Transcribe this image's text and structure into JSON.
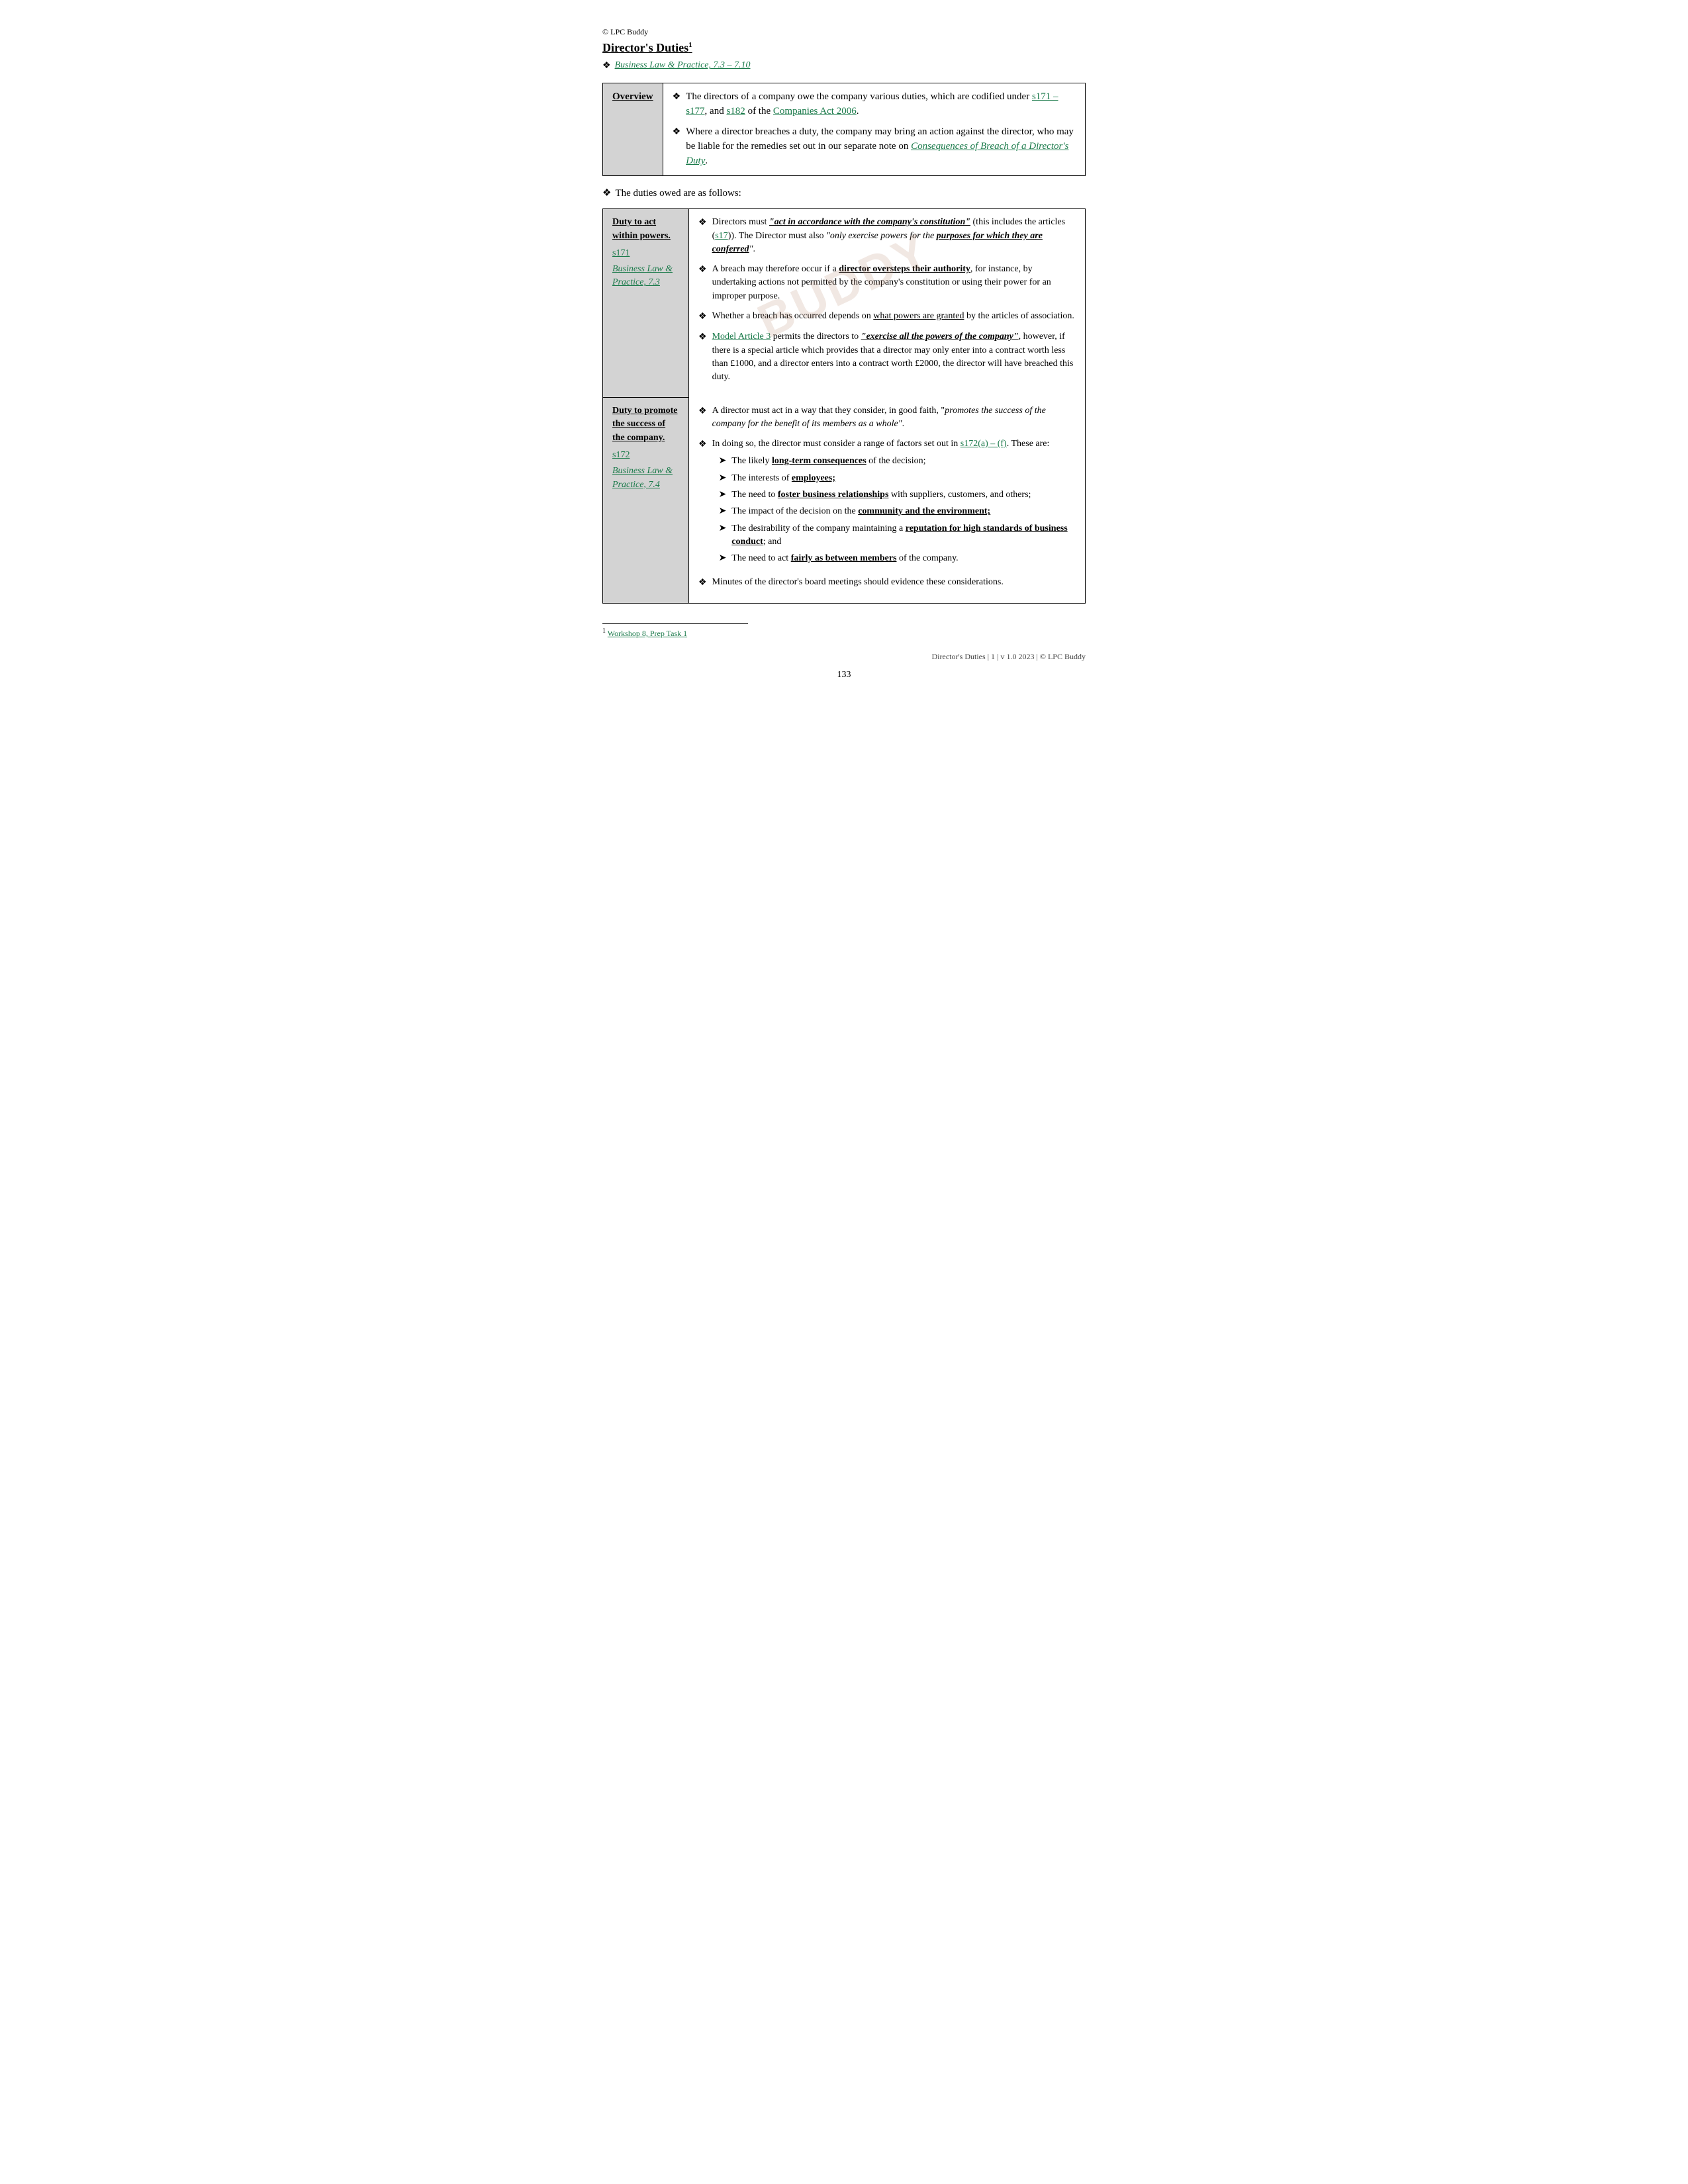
{
  "header": {
    "copyright": "© LPC Buddy",
    "title": "Director's Duties",
    "title_superscript": "1",
    "reference_text": "Business Law & Practice, 7.3 – 7.10"
  },
  "overview": {
    "label": "Overview",
    "items": [
      {
        "text_before": "The directors of a company owe the company various duties, which are codified under ",
        "link1_text": "s171 – s177",
        "link1_href": "#s171",
        "text_middle": ", and ",
        "link2_text": "s182",
        "link2_href": "#s182",
        "text_after": " of the ",
        "link3_text": "Companies Act 2006",
        "link3_href": "#ca2006",
        "text_end": "."
      },
      {
        "text_before": "Where a director breaches a duty, the company may bring an action against the director, who may be liable for the remedies set out in our separate note on ",
        "link_text": "Consequences of Breach of a Director's Duty",
        "link_href": "#consequences",
        "text_after": "."
      }
    ]
  },
  "duties_intro": "The duties owed are as follows:",
  "duties": [
    {
      "left": {
        "title": "Duty to act within powers.",
        "refs": [
          {
            "text": "s171",
            "href": "#s171"
          },
          {
            "text": "Business Law & Practice, 7.3",
            "href": "#blp73"
          }
        ]
      },
      "right": {
        "bullets": [
          {
            "type": "text",
            "parts": [
              {
                "text": "Directors must ",
                "style": "normal"
              },
              {
                "text": "“act in accordance with the company’s constitution”",
                "style": "bold-italic-underline"
              },
              {
                "text": " (this includes the articles (",
                "style": "normal"
              },
              {
                "text": "s17",
                "style": "link",
                "href": "#s17"
              },
              {
                "text": ")). The Director must also ",
                "style": "normal"
              },
              {
                "text": "“only exercise powers for the ",
                "style": "italic"
              },
              {
                "text": "purposes for which they are conferred",
                "style": "bold-italic-underline"
              },
              {
                "text": "”.",
                "style": "italic"
              }
            ]
          },
          {
            "type": "text",
            "parts": [
              {
                "text": "A breach may therefore occur if a ",
                "style": "normal"
              },
              {
                "text": "director oversteps their authority",
                "style": "bold-underline"
              },
              {
                "text": ", for instance, by undertaking actions not permitted by the company’s constitution or using their power for an improper purpose.",
                "style": "normal"
              }
            ]
          },
          {
            "type": "text",
            "parts": [
              {
                "text": "Whether a breach has occurred depends on ",
                "style": "normal"
              },
              {
                "text": "what powers are granted",
                "style": "underline"
              },
              {
                "text": " by the articles of association.",
                "style": "normal"
              }
            ]
          },
          {
            "type": "text",
            "parts": [
              {
                "text": "Model Article 3",
                "style": "link",
                "href": "#model3"
              },
              {
                "text": " permits the directors to ",
                "style": "normal"
              },
              {
                "text": "“exercise all the powers of the company”",
                "style": "bold-italic-underline"
              },
              {
                "text": ", however, if there is a special article which provides that a director may only enter into a contract worth less than £1000, and a director enters into a contract worth £2000, the director will have breached this duty.",
                "style": "normal"
              }
            ]
          }
        ]
      }
    },
    {
      "left": {
        "title": "Duty to promote the success of the company.",
        "refs": [
          {
            "text": "s172",
            "href": "#s172"
          },
          {
            "text": "Business Law & Practice, 7.4",
            "href": "#blp74"
          }
        ]
      },
      "right": {
        "bullets": [
          {
            "type": "text",
            "parts": [
              {
                "text": "A director must act in a way that they consider, in good faith, “",
                "style": "normal"
              },
              {
                "text": "promotes the success of the company for the benefit of its members as a whole”.",
                "style": "italic"
              }
            ]
          },
          {
            "type": "text_with_list",
            "parts_before": [
              {
                "text": "In doing so, the director must consider a range of factors set out in ",
                "style": "normal"
              },
              {
                "text": "s172(a) – (f)",
                "style": "link",
                "href": "#s172af"
              },
              {
                "text": ". These are:",
                "style": "normal"
              }
            ],
            "list_items": [
              {
                "parts": [
                  {
                    "text": "The likely ",
                    "style": "normal"
                  },
                  {
                    "text": "long-term consequences",
                    "style": "bold-underline"
                  },
                  {
                    "text": " of the decision;",
                    "style": "normal"
                  }
                ]
              },
              {
                "parts": [
                  {
                    "text": "The interests of ",
                    "style": "normal"
                  },
                  {
                    "text": "employees;",
                    "style": "bold-underline"
                  }
                ]
              },
              {
                "parts": [
                  {
                    "text": "The need to ",
                    "style": "normal"
                  },
                  {
                    "text": "foster business relationships",
                    "style": "bold-underline"
                  },
                  {
                    "text": " with suppliers, customers, and others;",
                    "style": "normal"
                  }
                ]
              },
              {
                "parts": [
                  {
                    "text": "The impact of the decision on the ",
                    "style": "normal"
                  },
                  {
                    "text": "community and the environment;",
                    "style": "bold-underline"
                  }
                ]
              },
              {
                "parts": [
                  {
                    "text": "The desirability of the company maintaining a ",
                    "style": "normal"
                  },
                  {
                    "text": "reputation for high standards of business conduct",
                    "style": "bold-underline"
                  },
                  {
                    "text": "; and",
                    "style": "normal"
                  }
                ]
              },
              {
                "parts": [
                  {
                    "text": "The need to act ",
                    "style": "normal"
                  },
                  {
                    "text": "fairly as between members",
                    "style": "bold-underline"
                  },
                  {
                    "text": " of the company.",
                    "style": "normal"
                  }
                ]
              }
            ]
          },
          {
            "type": "text",
            "parts": [
              {
                "text": "Minutes of the director’s board meetings should evidence these considerations.",
                "style": "normal"
              }
            ]
          }
        ]
      }
    }
  ],
  "footnote": {
    "number": "1",
    "text": "Workshop 8, Prep Task 1",
    "href": "#workshop8"
  },
  "footer": {
    "text": "Director's Duties | 1 | v 1.0 2023 | © LPC Buddy"
  },
  "page_number": "133",
  "watermark_text": "BUDDY"
}
